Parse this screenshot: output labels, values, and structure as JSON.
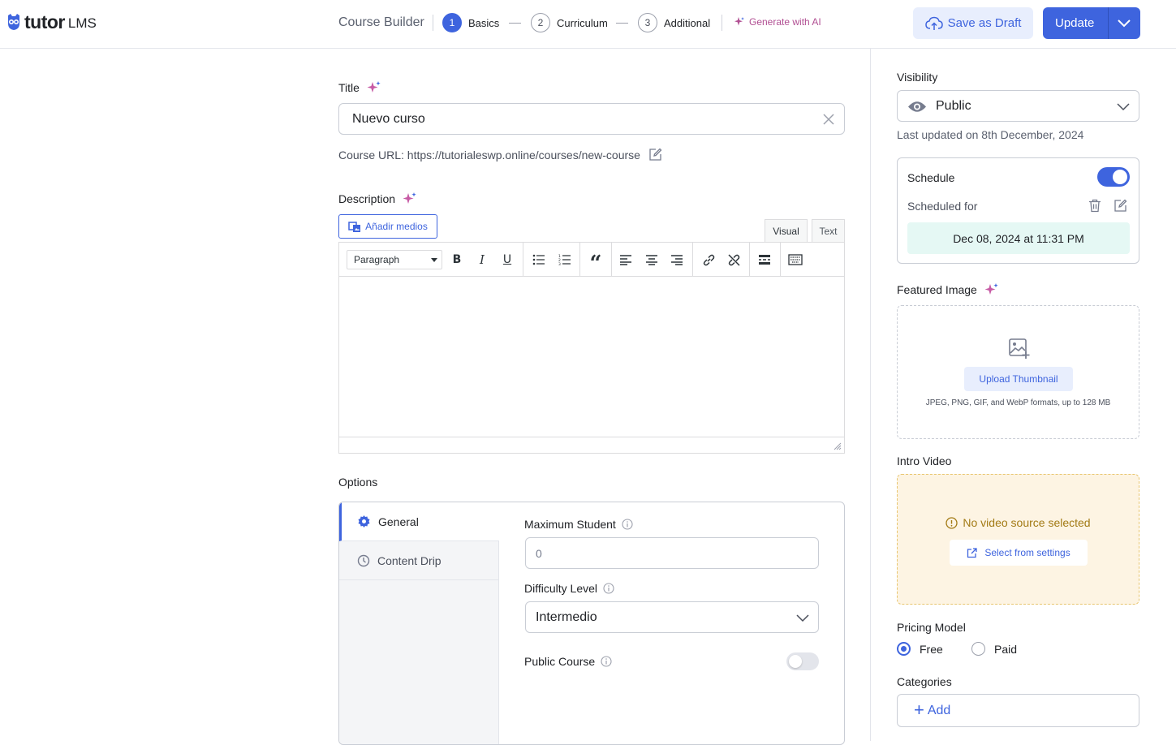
{
  "brand": {
    "name": "tutor",
    "suffix": "LMS"
  },
  "header": {
    "title": "Course Builder",
    "steps": [
      {
        "num": "1",
        "label": "Basics",
        "active": true
      },
      {
        "num": "2",
        "label": "Curriculum",
        "active": false
      },
      {
        "num": "3",
        "label": "Additional",
        "active": false
      }
    ],
    "generate_ai": "Generate with AI",
    "save_draft": "Save as Draft",
    "update": "Update"
  },
  "main": {
    "title_label": "Title",
    "title_value": "Nuevo curso",
    "course_url": "Course URL: https://tutorialeswp.online/courses/new-course",
    "description_label": "Description",
    "add_media": "Añadir medios",
    "editor_tabs": {
      "visual": "Visual",
      "text": "Text"
    },
    "format_select": "Paragraph",
    "options_label": "Options",
    "option_tabs": [
      {
        "label": "General",
        "active": true
      },
      {
        "label": "Content Drip",
        "active": false
      }
    ],
    "max_student_label": "Maximum Student",
    "max_student_value": "0",
    "difficulty_label": "Difficulty Level",
    "difficulty_value": "Intermedio",
    "public_course_label": "Public Course",
    "public_course_enabled": false
  },
  "sidebar": {
    "visibility_label": "Visibility",
    "visibility_value": "Public",
    "last_updated": "Last updated on 8th December, 2024",
    "schedule_label": "Schedule",
    "schedule_enabled": true,
    "scheduled_for_label": "Scheduled for",
    "scheduled_date": "Dec 08, 2024 at 11:31 PM",
    "featured_image_label": "Featured Image",
    "upload_thumbnail": "Upload Thumbnail",
    "formats": "JPEG, PNG, GIF, and WebP formats, up to 128 MB",
    "intro_video_label": "Intro Video",
    "no_video": "No video source selected",
    "select_settings": "Select from settings",
    "pricing_label": "Pricing Model",
    "pricing_options": [
      {
        "label": "Free",
        "selected": true
      },
      {
        "label": "Paid",
        "selected": false
      }
    ],
    "categories_label": "Categories",
    "add_category": "Add"
  },
  "colors": {
    "accent": "#3e64de",
    "ai": "#b14f93",
    "warning_bg": "#fdf4e3",
    "schedule_bg": "#e5f8f4"
  }
}
